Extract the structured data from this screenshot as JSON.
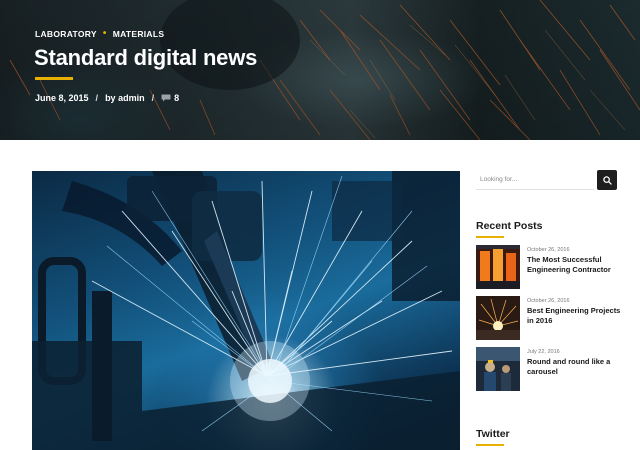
{
  "hero": {
    "categories": [
      "LABORATORY",
      "MATERIALS"
    ],
    "separator": "•",
    "title": "Standard digital news",
    "date": "June 8, 2015",
    "slash": "/",
    "author": "by admin",
    "comment_count": "8",
    "accent_color": "#e8b100"
  },
  "search": {
    "placeholder": "Looking for...",
    "button_icon": "search-icon"
  },
  "recent_posts": {
    "title": "Recent Posts",
    "items": [
      {
        "date": "October 26, 2016",
        "title": "The Most Successful Engineering Contractor"
      },
      {
        "date": "October 26, 2016",
        "title": "Best Engineering Projects in 2016"
      },
      {
        "date": "July 22, 2016",
        "title": "Round and round like a carousel"
      }
    ]
  },
  "twitter": {
    "title": "Twitter"
  }
}
